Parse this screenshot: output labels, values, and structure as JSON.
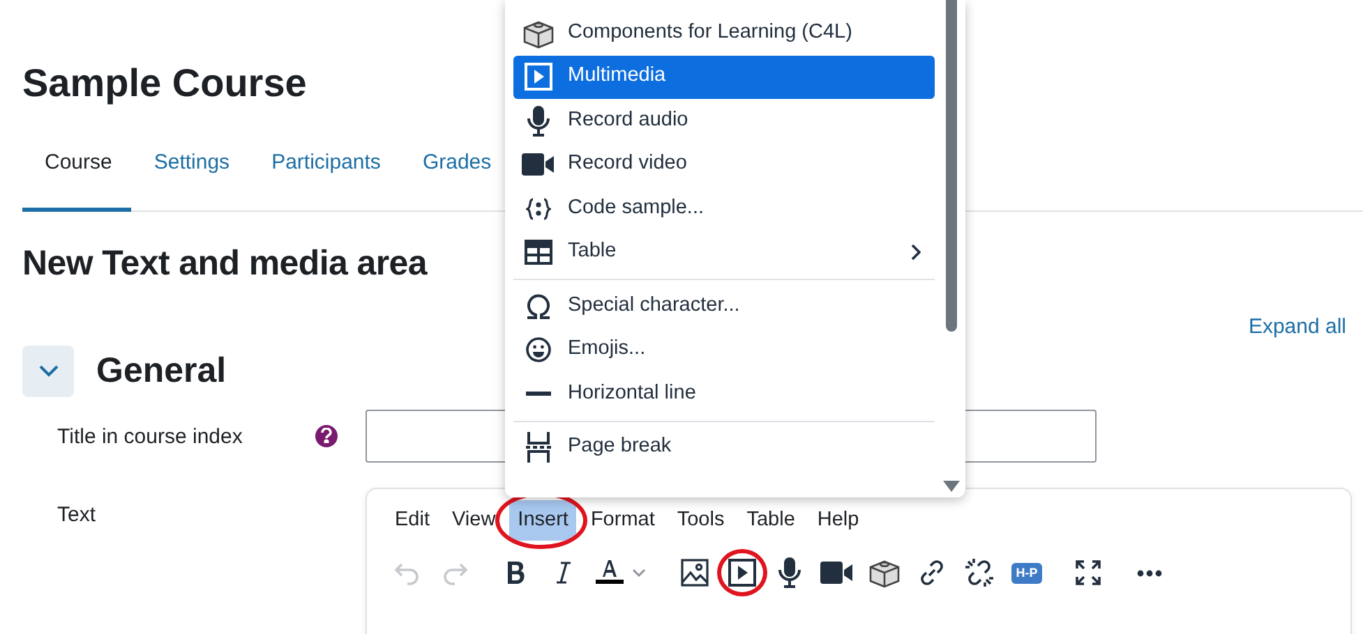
{
  "page": {
    "course_title": "Sample Course",
    "tabs": [
      {
        "label": "Course",
        "selected": true
      },
      {
        "label": "Settings",
        "selected": false
      },
      {
        "label": "Participants",
        "selected": false
      },
      {
        "label": "Grades",
        "selected": false
      }
    ],
    "heading": "New Text and media area",
    "expand_all": "Expand all",
    "section": {
      "title": "General",
      "expanded": true
    },
    "fields": [
      {
        "label": "Title in course index",
        "help": true,
        "kind": "text"
      },
      {
        "label": "Text",
        "help": false,
        "kind": "editor"
      }
    ]
  },
  "editor": {
    "menubar": [
      {
        "label": "Edit",
        "selected": false,
        "highlighted": false
      },
      {
        "label": "View",
        "selected": false,
        "highlighted": false
      },
      {
        "label": "Insert",
        "selected": true,
        "highlighted": true
      },
      {
        "label": "Format",
        "selected": false,
        "highlighted": false
      },
      {
        "label": "Tools",
        "selected": false,
        "highlighted": false
      },
      {
        "label": "Table",
        "selected": false,
        "highlighted": false
      },
      {
        "label": "Help",
        "selected": false,
        "highlighted": false
      }
    ],
    "toolbar": [
      [
        {
          "kind": "undo",
          "disabled": true,
          "highlighted": false
        },
        {
          "kind": "redo",
          "disabled": true,
          "highlighted": false
        }
      ],
      [
        {
          "kind": "bold",
          "disabled": false,
          "highlighted": false
        },
        {
          "kind": "italic",
          "disabled": false,
          "highlighted": false
        },
        {
          "kind": "font-color",
          "disabled": false,
          "highlighted": false
        }
      ],
      [
        {
          "kind": "image",
          "disabled": false,
          "highlighted": false
        },
        {
          "kind": "multimedia",
          "disabled": false,
          "highlighted": true
        },
        {
          "kind": "audio",
          "disabled": false,
          "highlighted": false
        },
        {
          "kind": "video",
          "disabled": false,
          "highlighted": false
        },
        {
          "kind": "c4l",
          "disabled": false,
          "highlighted": false
        },
        {
          "kind": "link",
          "disabled": false,
          "highlighted": false
        },
        {
          "kind": "unlink",
          "disabled": false,
          "highlighted": false
        },
        {
          "kind": "h5p",
          "label": "H-P",
          "disabled": false,
          "highlighted": false
        }
      ],
      [
        {
          "kind": "fullscreen",
          "disabled": false,
          "highlighted": false
        }
      ],
      [
        {
          "kind": "more",
          "disabled": false,
          "highlighted": false
        }
      ]
    ]
  },
  "dropdown": {
    "groups": [
      [
        {
          "kind": "c4l",
          "label": "Components for Learning (C4L)",
          "selected": false,
          "submenu": false
        },
        {
          "kind": "multimedia",
          "label": "Multimedia",
          "selected": true,
          "submenu": false
        },
        {
          "kind": "audio",
          "label": "Record audio",
          "selected": false,
          "submenu": false
        },
        {
          "kind": "video",
          "label": "Record video",
          "selected": false,
          "submenu": false
        },
        {
          "kind": "code",
          "label": "Code sample...",
          "selected": false,
          "submenu": false
        },
        {
          "kind": "table",
          "label": "Table",
          "selected": false,
          "submenu": true
        }
      ],
      [
        {
          "kind": "omega",
          "label": "Special character...",
          "selected": false,
          "submenu": false
        },
        {
          "kind": "emoji",
          "label": "Emojis...",
          "selected": false,
          "submenu": false
        },
        {
          "kind": "hr",
          "label": "Horizontal line",
          "selected": false,
          "submenu": false
        }
      ],
      [
        {
          "kind": "pagebreak",
          "label": "Page break",
          "selected": false,
          "submenu": false
        }
      ]
    ]
  }
}
